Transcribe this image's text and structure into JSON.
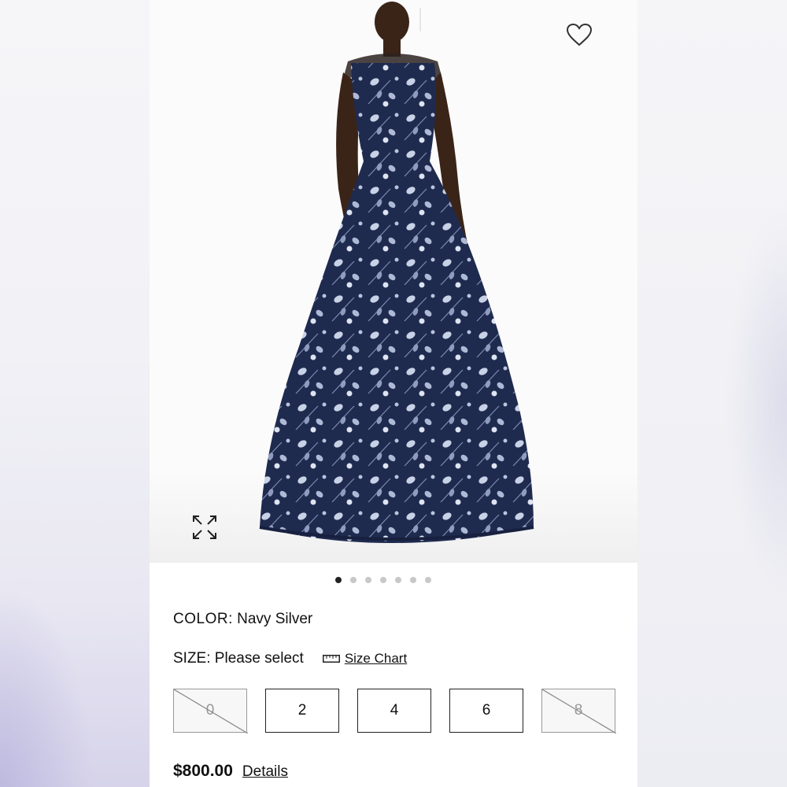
{
  "product": {
    "image_alt": "Navy floral embroidered gown",
    "color_label": "COLOR:",
    "color_value": "Navy Silver",
    "size_label": "SIZE:",
    "size_value": "Please select",
    "size_chart_label": "Size Chart",
    "sizes": [
      {
        "label": "0",
        "available": false
      },
      {
        "label": "2",
        "available": true
      },
      {
        "label": "4",
        "available": true
      },
      {
        "label": "6",
        "available": true
      },
      {
        "label": "8",
        "available": false
      }
    ],
    "price": "$800.00",
    "details_label": "Details"
  },
  "carousel": {
    "total": 7,
    "active_index": 0
  },
  "icons": {
    "favorite": "heart-outline-icon",
    "expand": "expand-arrows-icon",
    "size_chart": "ruler-icon"
  },
  "colors": {
    "dress": "#1f2a4f",
    "embroidery": "#c8d2e6",
    "skin": "#3a2418"
  }
}
